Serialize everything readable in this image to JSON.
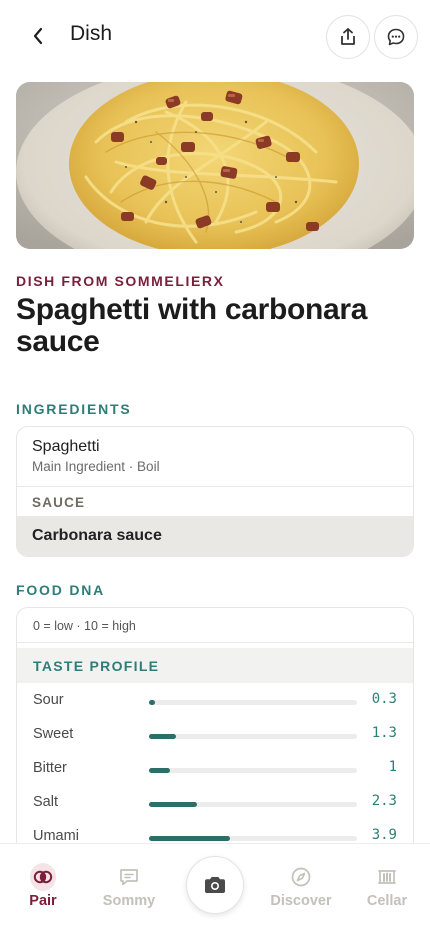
{
  "header": {
    "title": "Dish"
  },
  "hero": {
    "image": "spaghetti-carbonara-photo"
  },
  "dish": {
    "eyebrow": "DISH FROM SOMMELIERX",
    "title": "Spaghetti with carbonara sauce"
  },
  "ingredients": {
    "label": "INGREDIENTS",
    "main": {
      "name": "Spaghetti",
      "meta": "Main Ingredient · Boil"
    },
    "sauce_label": "SAUCE",
    "sauce": "Carbonara sauce"
  },
  "food_dna": {
    "label": "FOOD DNA",
    "scale_note": "0 = low · 10 = high",
    "taste_profile_label": "TASTE PROFILE",
    "tastes": [
      {
        "name": "Sour",
        "value": "0.3",
        "level": 0.03
      },
      {
        "name": "Sweet",
        "value": "1.3",
        "level": 0.13
      },
      {
        "name": "Bitter",
        "value": "1",
        "level": 0.1
      },
      {
        "name": "Salt",
        "value": "2.3",
        "level": 0.23
      },
      {
        "name": "Umami",
        "value": "3.9",
        "level": 0.39
      }
    ]
  },
  "nav": {
    "items": [
      {
        "label": "Pair",
        "icon": "pair-icon",
        "active": true
      },
      {
        "label": "Sommy",
        "icon": "sommy-chat-icon",
        "active": false
      },
      {
        "label": "Discover",
        "icon": "compass-icon",
        "active": false
      },
      {
        "label": "Cellar",
        "icon": "cellar-icon",
        "active": false
      }
    ],
    "center": {
      "icon": "camera-icon"
    }
  },
  "colors": {
    "accent_wine": "#7a1f3a",
    "accent_teal": "#2e7d78",
    "bar_fill": "#2c6e68",
    "inactive_nav": "#c4c0ba"
  }
}
